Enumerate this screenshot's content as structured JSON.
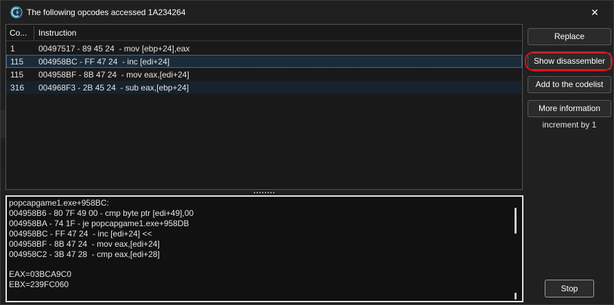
{
  "window": {
    "title": "The following opcodes accessed 1A234264",
    "close_glyph": "✕"
  },
  "list": {
    "columns": [
      "Co...",
      "Instruction"
    ],
    "rows": [
      {
        "count": "1",
        "instruction": "00497517 - 89 45 24  - mov [ebp+24],eax"
      },
      {
        "count": "115",
        "instruction": "004958BC - FF 47 24  - inc [edi+24]"
      },
      {
        "count": "115",
        "instruction": "004958BF - 8B 47 24  - mov eax,[edi+24]"
      },
      {
        "count": "316",
        "instruction": "004968F3 - 2B 45 24  - sub eax,[ebp+24]"
      }
    ]
  },
  "disassembly": {
    "lines": [
      "popcapgame1.exe+958BC:",
      "004958B6 - 80 7F 49 00 - cmp byte ptr [edi+49],00",
      "004958BA - 74 1F - je popcapgame1.exe+958DB",
      "004958BC - FF 47 24  - inc [edi+24] <<",
      "004958BF - 8B 47 24  - mov eax,[edi+24]",
      "004958C2 - 3B 47 28  - cmp eax,[edi+28]",
      "",
      "EAX=03BCA9C0",
      "EBX=239FC060"
    ]
  },
  "buttons": {
    "replace": "Replace",
    "show_disassembler": "Show disassembler",
    "add_to_codelist": "Add to the codelist",
    "more_information": "More information",
    "stop": "Stop"
  },
  "info_text": "increment by 1",
  "colors": {
    "annotation_ring": "#e0101a",
    "selected_row": "#1a2b3a"
  }
}
